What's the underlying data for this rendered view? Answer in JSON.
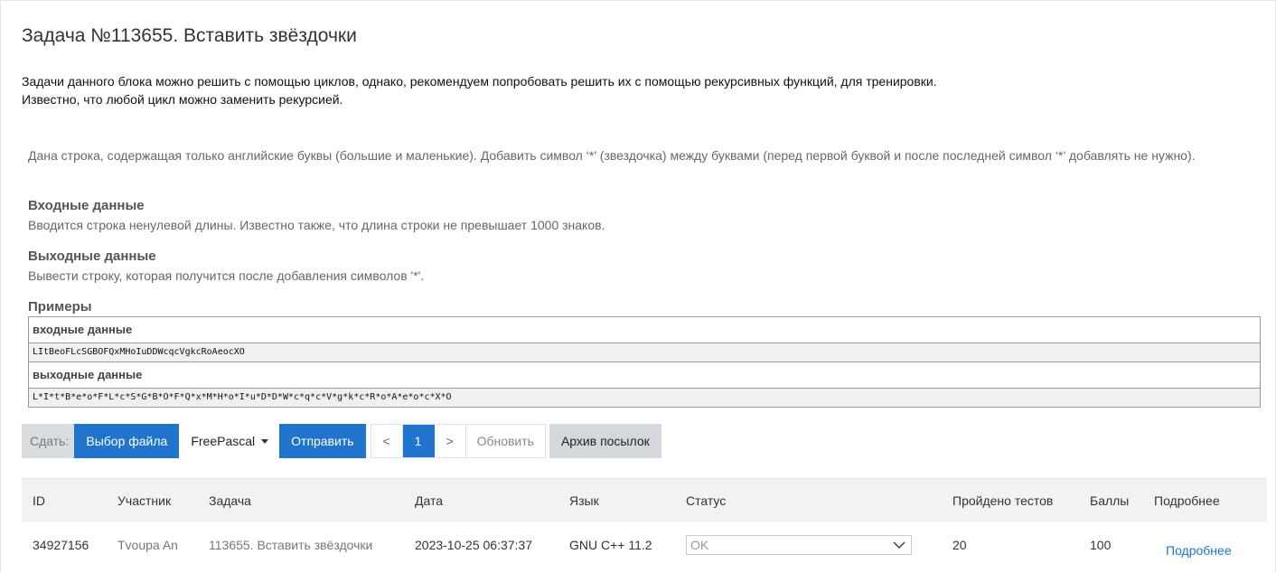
{
  "task": {
    "title": "Задача №113655. Вставить звёздочки",
    "intro_line1": "Задачи данного блока можно решить с помощью циклов, однако, рекомендуем попробовать решить их с помощью рекурсивных функций, для тренировки.",
    "intro_line2": "Известно, что любой цикл можно заменить рекурсией.",
    "statement": "Дана строка, содержащая только английские буквы (большие и маленькие). Добавить символ ‘*’ (звездочка) между буквами (перед первой буквой и после последней символ ‘*’ добавлять не нужно).",
    "input_head": "Входные данные",
    "input_text": "Вводится строка ненулевой длины. Известно также, что длина строки не превышает 1000 знаков.",
    "output_head": "Выходные данные",
    "output_text": "Вывести строку, которая получится после добавления символов '*'.",
    "examples_head": "Примеры",
    "ex_input_label": "входные данные",
    "ex_input_value": "LItBeoFLcSGBOFQxMHoIuDDWcqcVgkcRoAeocXO",
    "ex_output_label": "выходные данные",
    "ex_output_value": "L*I*t*B*e*o*F*L*c*S*G*B*O*F*Q*x*M*H*o*I*u*D*D*W*c*q*c*V*g*k*c*R*o*A*e*o*c*X*O"
  },
  "toolbar": {
    "submit_label": "Сдать:",
    "choose_file": "Выбор файла",
    "language": "FreePascal",
    "send": "Отправить",
    "prev": "<",
    "page": "1",
    "next": ">",
    "refresh": "Обновить",
    "archive": "Архив посылок"
  },
  "table": {
    "headers": {
      "id": "ID",
      "participant": "Участник",
      "task": "Задача",
      "date": "Дата",
      "lang": "Язык",
      "status": "Статус",
      "tests": "Пройдено тестов",
      "score": "Баллы",
      "details": "Подробнее"
    },
    "rows": [
      {
        "id": "34927156",
        "participant": "Tvoupa An",
        "task": "113655. Вставить звёздочки",
        "date": "2023-10-25 06:37:37",
        "lang": "GNU C++ 11.2",
        "status": "OK",
        "tests": "20",
        "score": "100",
        "details": "Подробнее"
      }
    ]
  },
  "colors": {
    "primary": "#1f75cc",
    "header_bg": "#f2f2f2"
  }
}
